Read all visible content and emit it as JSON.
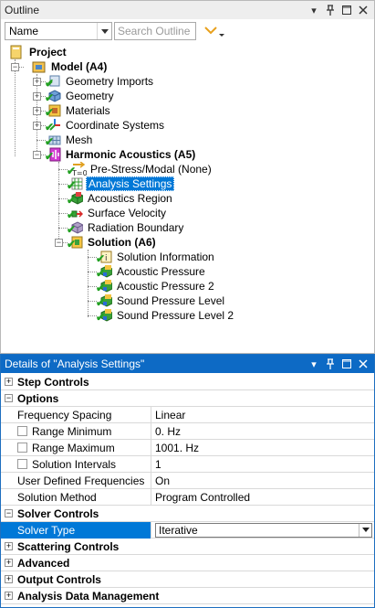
{
  "outline": {
    "title": "Outline",
    "filter_combo": {
      "value": "Name"
    },
    "search": {
      "placeholder": "Search Outline"
    },
    "tree": [
      {
        "label": "Project",
        "icon": "project-icon",
        "bold": true
      },
      {
        "label": "Model (A4)",
        "icon": "model-icon",
        "bold": true
      },
      {
        "label": "Geometry Imports",
        "icon": "geometry-imports-icon"
      },
      {
        "label": "Geometry",
        "icon": "geometry-icon"
      },
      {
        "label": "Materials",
        "icon": "materials-icon"
      },
      {
        "label": "Coordinate Systems",
        "icon": "coordinate-systems-icon"
      },
      {
        "label": "Mesh",
        "icon": "mesh-icon"
      },
      {
        "label": "Harmonic Acoustics (A5)",
        "icon": "harmonic-acoustics-icon",
        "bold": true
      },
      {
        "label": "Pre-Stress/Modal (None)",
        "icon": "prestress-icon"
      },
      {
        "label": "Analysis Settings",
        "icon": "analysis-settings-icon",
        "selected": true
      },
      {
        "label": "Acoustics Region",
        "icon": "acoustics-region-icon"
      },
      {
        "label": "Surface Velocity",
        "icon": "surface-velocity-icon"
      },
      {
        "label": "Radiation Boundary",
        "icon": "radiation-boundary-icon"
      },
      {
        "label": "Solution (A6)",
        "icon": "solution-icon",
        "bold": true
      },
      {
        "label": "Solution Information",
        "icon": "solution-information-icon"
      },
      {
        "label": "Acoustic Pressure",
        "icon": "result-icon"
      },
      {
        "label": "Acoustic Pressure 2",
        "icon": "result-icon"
      },
      {
        "label": "Sound Pressure Level",
        "icon": "result-icon"
      },
      {
        "label": "Sound Pressure Level 2",
        "icon": "result-icon"
      }
    ]
  },
  "details": {
    "title": "Details of \"Analysis Settings\"",
    "categories": {
      "step_controls": "Step Controls",
      "options": "Options",
      "solver_controls": "Solver Controls",
      "scattering_controls": "Scattering Controls",
      "advanced": "Advanced",
      "output_controls": "Output Controls",
      "analysis_data_management": "Analysis Data Management"
    },
    "options": [
      {
        "key": "Frequency Spacing",
        "value": "Linear"
      },
      {
        "key": "Range Minimum",
        "value": "0. Hz",
        "checkbox": true
      },
      {
        "key": "Range Maximum",
        "value": "1001. Hz",
        "checkbox": true
      },
      {
        "key": "Solution Intervals",
        "value": "1",
        "checkbox": true
      },
      {
        "key": "User Defined Frequencies",
        "value": "On"
      },
      {
        "key": "Solution Method",
        "value": "Program Controlled"
      }
    ],
    "solver": {
      "key": "Solver Type",
      "value": "Iterative"
    }
  },
  "colors": {
    "selection": "#0078d7",
    "details_title_bar": "#0d6ac5",
    "check": "#23a023"
  }
}
